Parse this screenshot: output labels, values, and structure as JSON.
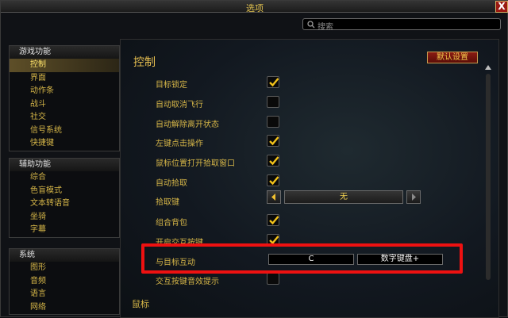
{
  "window": {
    "title": "选项",
    "close_glyph": "X"
  },
  "search": {
    "placeholder": "搜索"
  },
  "sidebar": {
    "categories": [
      {
        "header": "游戏功能",
        "items": [
          "控制",
          "界面",
          "动作条",
          "战斗",
          "社交",
          "信号系统",
          "快捷键"
        ],
        "selected": "控制"
      },
      {
        "header": "辅助功能",
        "items": [
          "综合",
          "色盲模式",
          "文本转语音",
          "坐骑",
          "字幕"
        ]
      },
      {
        "header": "系统",
        "items": [
          "图形",
          "音频",
          "语言",
          "网络"
        ]
      }
    ]
  },
  "main": {
    "title": "控制",
    "defaults_button": "默认设置",
    "rows": [
      {
        "label": "目标锁定",
        "checked": true
      },
      {
        "label": "自动取消飞行",
        "checked": false
      },
      {
        "label": "自动解除离开状态",
        "checked": false
      },
      {
        "label": "左键点击操作",
        "checked": true
      },
      {
        "label": "鼠标位置打开拾取窗口",
        "checked": true
      },
      {
        "label": "自动拾取",
        "checked": true
      },
      {
        "label": "拾取键",
        "dropdown": "无"
      },
      {
        "label": "组合背包",
        "checked": true
      },
      {
        "label": "开启交互按键",
        "checked": true
      },
      {
        "label": "与目标互动",
        "keys": [
          "C",
          "数字键盘+"
        ]
      },
      {
        "label": "交互按键音效提示",
        "checked": false
      }
    ],
    "section_label": "鼠标"
  },
  "colors": {
    "highlight": "#ee1111",
    "accent_gold": "#d6b648",
    "button_red": "#8a1b12"
  }
}
